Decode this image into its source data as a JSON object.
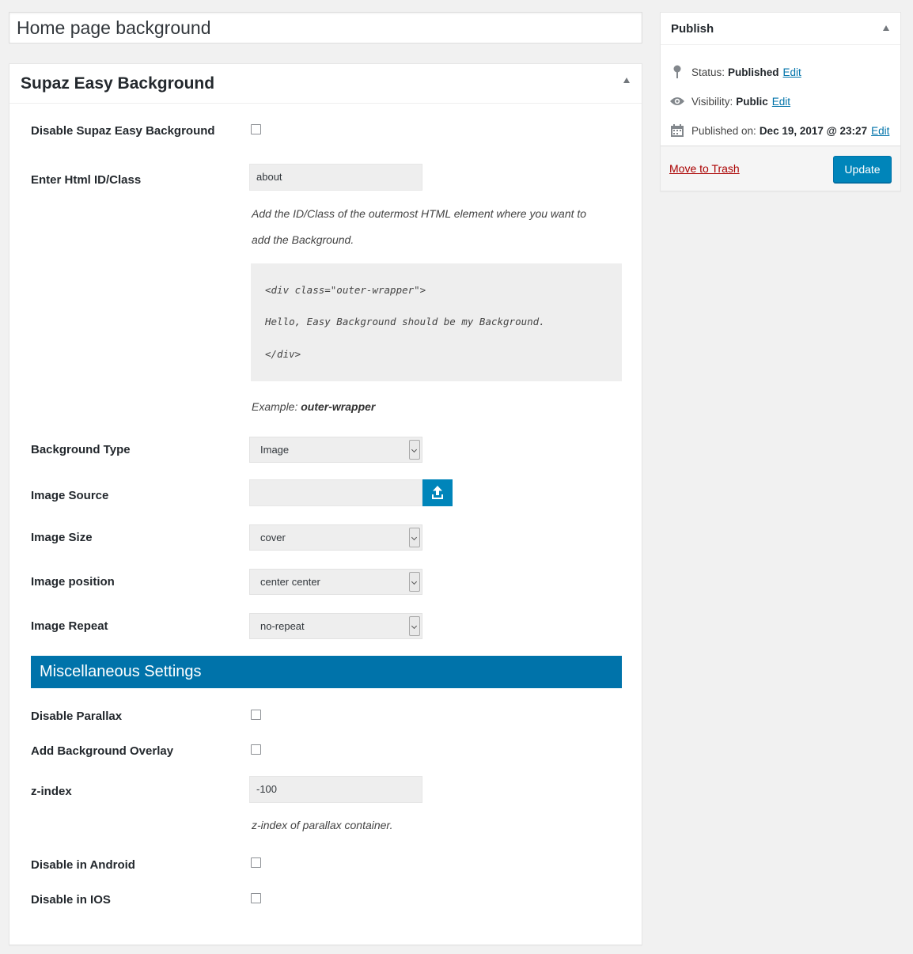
{
  "post_title": "Home page background",
  "metabox": {
    "title": "Supaz Easy Background",
    "fields": {
      "disable_label": "Disable Supaz Easy Background",
      "html_id_label": "Enter Html ID/Class",
      "html_id_value": "about",
      "help_line1": "Add the ID/Class of the outermost HTML element where you want to",
      "help_line2": "add the Background.",
      "code_line1": "<div class=\"outer-wrapper\">",
      "code_line2": "Hello, Easy Background should be my Background.",
      "code_line3": "</div>",
      "example_prefix": "Example:",
      "example_value": "outer-wrapper",
      "bg_type_label": "Background Type",
      "bg_type_value": "Image",
      "image_source_label": "Image Source",
      "image_source_value": "",
      "image_size_label": "Image Size",
      "image_size_value": "cover",
      "image_position_label": "Image position",
      "image_position_value": "center center",
      "image_repeat_label": "Image Repeat",
      "image_repeat_value": "no-repeat"
    },
    "misc": {
      "heading": "Miscellaneous Settings",
      "disable_parallax_label": "Disable Parallax",
      "add_overlay_label": "Add Background Overlay",
      "zindex_label": "z-index",
      "zindex_value": "-100",
      "zindex_help": "z-index of parallax container.",
      "disable_android_label": "Disable in Android",
      "disable_ios_label": "Disable in IOS"
    }
  },
  "publish": {
    "title": "Publish",
    "status_label": "Status:",
    "status_value": "Published",
    "visibility_label": "Visibility:",
    "visibility_value": "Public",
    "published_label": "Published on:",
    "published_value": "Dec 19, 2017 @ 23:27",
    "edit_label": "Edit",
    "trash_label": "Move to Trash",
    "update_label": "Update"
  },
  "icons": [
    "pin-icon",
    "eye-icon",
    "calendar-icon",
    "upload-icon",
    "toggle-arrow-icon"
  ],
  "colors": {
    "accent": "#0073aa",
    "button": "#0085ba",
    "trash": "#a00"
  }
}
